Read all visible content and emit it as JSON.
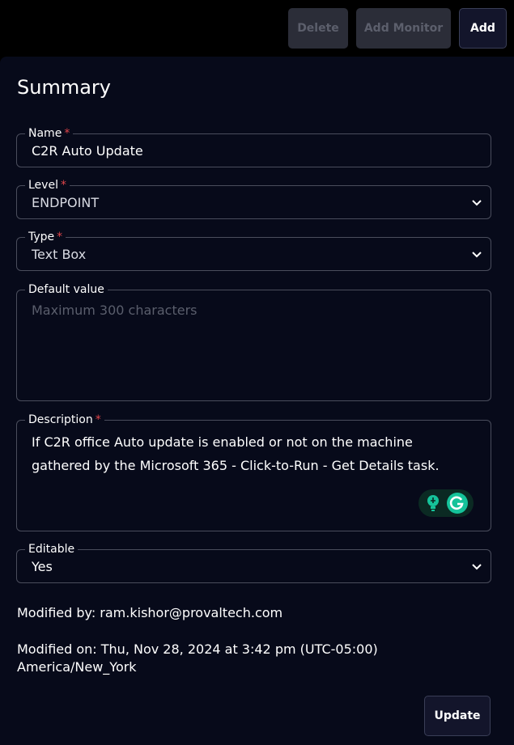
{
  "toolbar": {
    "delete_label": "Delete",
    "add_monitor_label": "Add Monitor",
    "add_label": "Add"
  },
  "summary": {
    "title": "Summary",
    "name": {
      "label": "Name",
      "required_mark": "*",
      "value": "C2R Auto Update"
    },
    "level": {
      "label": "Level",
      "required_mark": "*",
      "value": "ENDPOINT"
    },
    "type": {
      "label": "Type",
      "required_mark": "*",
      "value": "Text Box"
    },
    "default_value": {
      "label": "Default value",
      "placeholder": "Maximum 300 characters"
    },
    "description": {
      "label": "Description",
      "required_mark": "*",
      "line1": "If C2R office Auto update is enabled or not on the machine",
      "line2": "gathered by the Microsoft 365 - Click-to-Run - Get Details task."
    },
    "editable": {
      "label": "Editable",
      "value": "Yes"
    },
    "modified_by": "Modified by: ram.kishor@provaltech.com",
    "modified_on_line1": "Modified on: Thu, Nov 28, 2024 at 3:42 pm (UTC-05:00)",
    "modified_on_line2": "America/New_York",
    "update_label": "Update"
  },
  "colors": {
    "page_bg": "#000000",
    "panel_bg": "#070a1a",
    "field_border": "#4a4d5c",
    "required": "#e0454a",
    "disabled_button": "#2b2d38",
    "primary_button": "#13152b",
    "grammarly_green": "#15c39a"
  },
  "icons": [
    "chevron-down-icon",
    "lightbulb-icon",
    "grammarly-icon"
  ]
}
